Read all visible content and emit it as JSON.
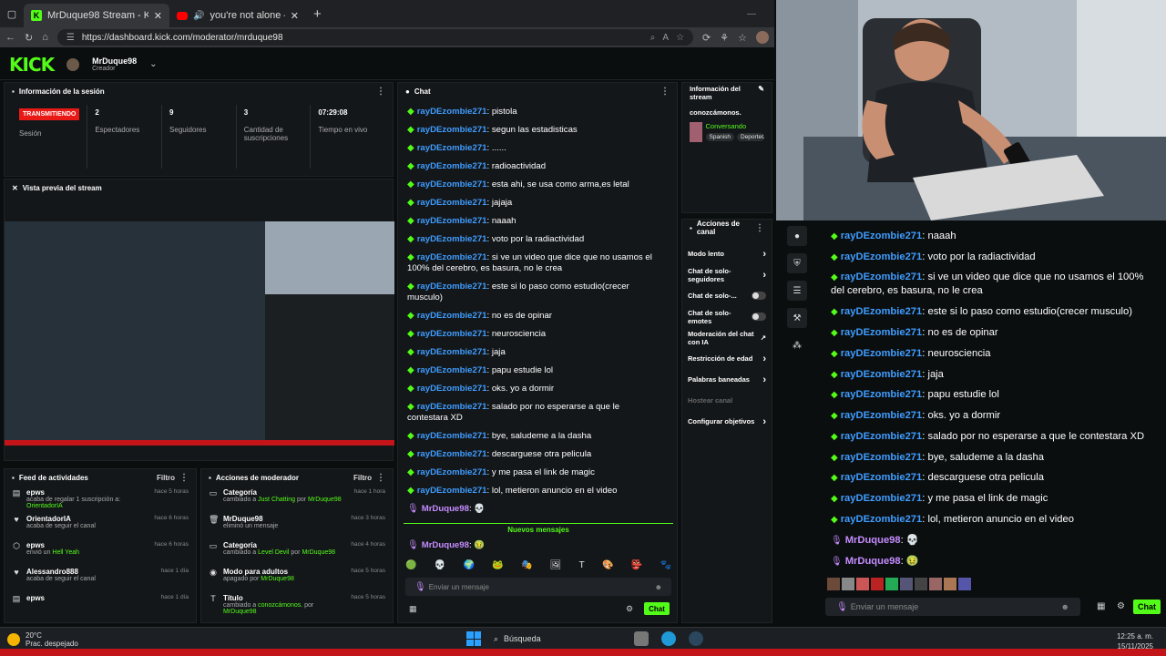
{
  "browser": {
    "tabs": [
      {
        "title": "MrDuque98 Stream - Kick Dashb",
        "active": true
      },
      {
        "title": "you're not alone — dreamc",
        "active": false
      }
    ],
    "url": "https://dashboard.kick.com/moderator/mrduque98"
  },
  "kick": {
    "logo": "KICK",
    "user": {
      "name": "MrDuque98",
      "role": "Creador"
    }
  },
  "session": {
    "title": "Información de la sesión",
    "live_badge": "TRANSMITIENDO",
    "stats": [
      {
        "value": "",
        "label": "Sesión"
      },
      {
        "value": "2",
        "label": "Espectadores"
      },
      {
        "value": "9",
        "label": "Seguidores"
      },
      {
        "value": "3",
        "label": "Cantidad de suscripciones"
      },
      {
        "value": "07:29:08",
        "label": "Tiempo en vivo"
      }
    ]
  },
  "preview": {
    "title": "Vista previa del stream"
  },
  "feed": {
    "title": "Feed de actividades",
    "filter": "Filtro",
    "items": [
      {
        "icon": "gift-icon",
        "glyph": "▤",
        "name": "epws",
        "pre": "acaba de regalar 1 suscripción a:",
        "hl": "OrientadorIA",
        "time": "hace 5 horas"
      },
      {
        "icon": "heart-icon",
        "glyph": "♥",
        "name": "OrientadorIA",
        "pre": "acaba de seguir el canal",
        "hl": "",
        "time": "hace 6 horas"
      },
      {
        "icon": "kick-icon",
        "glyph": "⬡",
        "name": "epws",
        "pre": "envió un",
        "hl": "Hell Yeah",
        "time": "hace 6 horas"
      },
      {
        "icon": "heart-icon",
        "glyph": "♥",
        "name": "Alessandro888",
        "pre": "acaba de seguir el canal",
        "hl": "",
        "time": "hace 1 día"
      },
      {
        "icon": "gift-icon",
        "glyph": "▤",
        "name": "epws",
        "pre": "",
        "hl": "",
        "time": "hace 1 día"
      }
    ]
  },
  "modactions": {
    "title": "Acciones de moderador",
    "filter": "Filtro",
    "items": [
      {
        "icon": "category-icon",
        "glyph": "▭",
        "name": "Categoría",
        "pre": "cambiado a",
        "hl": "Just Chatting",
        "post": "por",
        "by": "MrDuque98",
        "time": "hace 1 hora"
      },
      {
        "icon": "trash-icon",
        "glyph": "🗑",
        "name": "MrDuque98",
        "pre": "eliminó un mensaje",
        "hl": "",
        "post": "",
        "by": "",
        "time": "hace 3 horas"
      },
      {
        "icon": "category-icon",
        "glyph": "▭",
        "name": "Categoría",
        "pre": "cambiado a",
        "hl": "Level Devil",
        "post": "por",
        "by": "MrDuque98",
        "time": "hace 4 horas"
      },
      {
        "icon": "eye-icon",
        "glyph": "◉",
        "name": "Modo para adultos",
        "pre": "apagado por",
        "hl": "MrDuque98",
        "post": "",
        "by": "",
        "time": "hace 5 horas"
      },
      {
        "icon": "title-icon",
        "glyph": "T",
        "name": "Título",
        "pre": "cambiado a",
        "hl": "conozcámonos.",
        "post": "por",
        "by": "MrDuque98",
        "time": "hace 5 horas"
      }
    ]
  },
  "chat": {
    "title": "Chat",
    "messages": [
      {
        "user": "rayDEzombie271",
        "text": "pistola",
        "mod": false
      },
      {
        "user": "rayDEzombie271",
        "text": "segun las estadisticas",
        "mod": false
      },
      {
        "user": "rayDEzombie271",
        "text": "......",
        "mod": false
      },
      {
        "user": "rayDEzombie271",
        "text": "radioactividad",
        "mod": false
      },
      {
        "user": "rayDEzombie271",
        "text": "esta ahi, se usa como arma,es letal",
        "mod": false
      },
      {
        "user": "rayDEzombie271",
        "text": "jajaja",
        "mod": false
      },
      {
        "user": "rayDEzombie271",
        "text": "naaah",
        "mod": false
      },
      {
        "user": "rayDEzombie271",
        "text": "voto por la radiactividad",
        "mod": false
      },
      {
        "user": "rayDEzombie271",
        "text": "si ve un video que dice que no usamos el 100% del cerebro, es basura, no le crea",
        "mod": false
      },
      {
        "user": "rayDEzombie271",
        "text": "este si lo paso como estudio(crecer musculo)",
        "mod": false
      },
      {
        "user": "rayDEzombie271",
        "text": "no es de opinar",
        "mod": false
      },
      {
        "user": "rayDEzombie271",
        "text": "neurosciencia",
        "mod": false
      },
      {
        "user": "rayDEzombie271",
        "text": "jaja",
        "mod": false
      },
      {
        "user": "rayDEzombie271",
        "text": "papu estudie lol",
        "mod": false
      },
      {
        "user": "rayDEzombie271",
        "text": "oks. yo a dormir",
        "mod": false
      },
      {
        "user": "rayDEzombie271",
        "text": "salado por no esperarse a que le contestara XD",
        "mod": false
      },
      {
        "user": "rayDEzombie271",
        "text": "bye, saludeme a la dasha",
        "mod": false
      },
      {
        "user": "rayDEzombie271",
        "text": "descarguese otra pelicula",
        "mod": false
      },
      {
        "user": "rayDEzombie271",
        "text": "y me pasa el link de magic",
        "mod": false
      },
      {
        "user": "rayDEzombie271",
        "text": "lol, metieron anuncio en el video",
        "mod": false
      },
      {
        "user": "MrDuque98",
        "text": "💀",
        "mod": true
      }
    ],
    "new_messages": "Nuevos mensajes",
    "last": {
      "user": "MrDuque98",
      "text": "🤢"
    },
    "placeholder": "Enviar un mensaje",
    "send": "Chat"
  },
  "streaminfo": {
    "title": "Información del stream",
    "stream_title": "conozcámonos.",
    "category": "Conversando",
    "tags": [
      "Spanish",
      "DeporteC"
    ]
  },
  "channel_actions": {
    "title": "Acciones de canal",
    "items": [
      {
        "label": "Modo lento",
        "type": "arrow",
        "disabled": false
      },
      {
        "label": "Chat de solo-seguidores",
        "type": "arrow",
        "disabled": false
      },
      {
        "label": "Chat de solo-...",
        "type": "toggle",
        "disabled": false
      },
      {
        "label": "Chat de solo-emotes",
        "type": "toggle",
        "disabled": false
      },
      {
        "label": "Moderación del chat con IA",
        "type": "ext",
        "disabled": false
      },
      {
        "label": "Restricción de edad",
        "type": "arrow",
        "disabled": false
      },
      {
        "label": "Palabras baneadas",
        "type": "arrow",
        "disabled": false
      },
      {
        "label": "Hostear canal",
        "type": "none",
        "disabled": true
      },
      {
        "label": "Configurar objetivos",
        "type": "arrow",
        "disabled": false
      }
    ]
  },
  "right_chat": {
    "messages": [
      {
        "user": "rayDEzombie271",
        "text": "naaah",
        "mod": false
      },
      {
        "user": "rayDEzombie271",
        "text": "voto por la radiactividad",
        "mod": false
      },
      {
        "user": "rayDEzombie271",
        "text": "si ve un video que dice que no usamos el 100% del cerebro, es basura, no le crea",
        "mod": false
      },
      {
        "user": "rayDEzombie271",
        "text": "este si lo paso como estudio(crecer musculo)",
        "mod": false
      },
      {
        "user": "rayDEzombie271",
        "text": "no es de opinar",
        "mod": false
      },
      {
        "user": "rayDEzombie271",
        "text": "neurosciencia",
        "mod": false
      },
      {
        "user": "rayDEzombie271",
        "text": "jaja",
        "mod": false
      },
      {
        "user": "rayDEzombie271",
        "text": "papu estudie lol",
        "mod": false
      },
      {
        "user": "rayDEzombie271",
        "text": "oks. yo a dormir",
        "mod": false
      },
      {
        "user": "rayDEzombie271",
        "text": "salado por no esperarse a que le contestara XD",
        "mod": false
      },
      {
        "user": "rayDEzombie271",
        "text": "bye, saludeme a la dasha",
        "mod": false
      },
      {
        "user": "rayDEzombie271",
        "text": "descarguese otra pelicula",
        "mod": false
      },
      {
        "user": "rayDEzombie271",
        "text": "y me pasa el link de magic",
        "mod": false
      },
      {
        "user": "rayDEzombie271",
        "text": "lol, metieron anuncio en el video",
        "mod": false
      },
      {
        "user": "MrDuque98",
        "text": "💀",
        "mod": true
      },
      {
        "user": "MrDuque98",
        "text": "🤢",
        "mod": true
      }
    ],
    "placeholder": "Enviar un mensaje",
    "send": "Chat"
  },
  "taskbar": {
    "temp": "20°C",
    "weather": "Prac. despejado",
    "search": "Búsqueda",
    "time": "12:25 a. m.",
    "date": "15/11/2025"
  },
  "colors": {
    "kick_green": "#53fc18",
    "username_blue": "#3f9dff",
    "mod_purple": "#c58cff",
    "live_red": "#e91916"
  }
}
